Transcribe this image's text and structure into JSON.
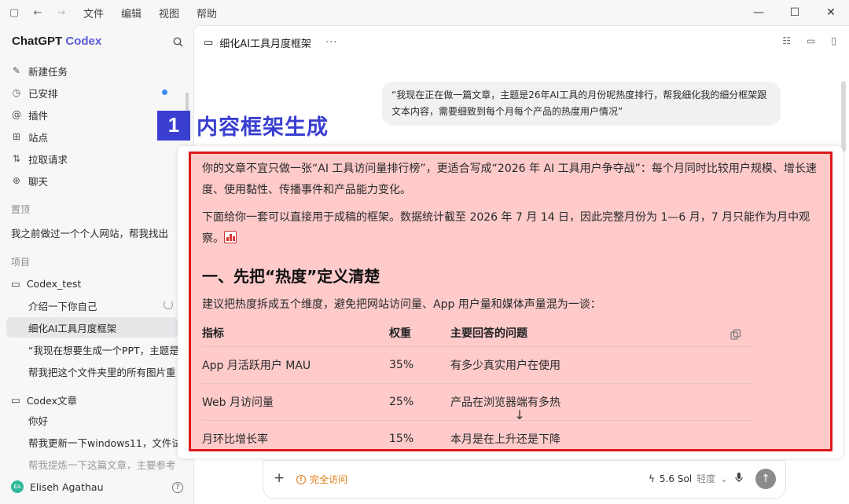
{
  "menu": [
    "文件",
    "编辑",
    "视图",
    "帮助"
  ],
  "brand": {
    "name": "ChatGPT",
    "accent": "Codex"
  },
  "nav": [
    {
      "label": "新建任务",
      "icon": "edit-icon"
    },
    {
      "label": "已安排",
      "icon": "clock-icon",
      "dot": true
    },
    {
      "label": "插件",
      "icon": "plugin-icon"
    },
    {
      "label": "站点",
      "icon": "grid-icon"
    },
    {
      "label": "拉取请求",
      "icon": "pull-request-icon"
    },
    {
      "label": "聊天",
      "icon": "chat-icon"
    }
  ],
  "sections": {
    "pinned": "置顶",
    "projects": "项目"
  },
  "pinned_item": "我之前做过一个个人网站，帮我找出",
  "projects": [
    {
      "name": "Codex_test",
      "threads": [
        "介绍一下你自己",
        "细化AI工具月度框架",
        "“我现在想要生成一个PPT，主题是",
        "帮我把这个文件夹里的所有图片重"
      ]
    },
    {
      "name": "Codex文章",
      "threads": [
        "你好",
        "帮我更新一下windows11，文件试",
        "帮我提炼一下这篇文章，主要参考"
      ]
    }
  ],
  "user": {
    "initials": "EA",
    "name": "Eliseh Agathau"
  },
  "thread_title": "细化AI工具月度框架",
  "user_message": "“我现在正在做一篇文章，主题是26年AI工具的月份呢热度排行，帮我细化我的细分框架跟文本内容，需要细致到每个月每个产品的热度用户情况”",
  "banner": {
    "num": "1",
    "text": "内容框架生成"
  },
  "response": {
    "p1": "你的文章不宜只做一张“AI 工具访问量排行榜”，更适合写成“2026 年 AI 工具用户争夺战”：每个月同时比较用户规模、增长速度、使用黏性、传播事件和产品能力变化。",
    "p2": "下面给你一套可以直接用于成稿的框架。数据统计截至 2026 年 7 月 14 日，因此完整月份为 1—6 月，7 月只能作为月中观察。",
    "h1": "一、先把“热度”定义清楚",
    "lead": "建议把热度拆成五个维度，避免把网站访问量、App 用户量和媒体声量混为一谈：",
    "table": {
      "headers": [
        "指标",
        "权重",
        "主要回答的问题"
      ],
      "rows": [
        [
          "App 月活跃用户 MAU",
          "35%",
          "有多少真实用户在使用"
        ],
        [
          "Web 月访问量",
          "25%",
          "产品在浏览器端有多热"
        ],
        [
          "月环比增长率",
          "15%",
          "本月是在上升还是下降"
        ]
      ]
    }
  },
  "composer": {
    "access": "完全访问",
    "model": "5.6 Sol",
    "level": "轻度"
  }
}
